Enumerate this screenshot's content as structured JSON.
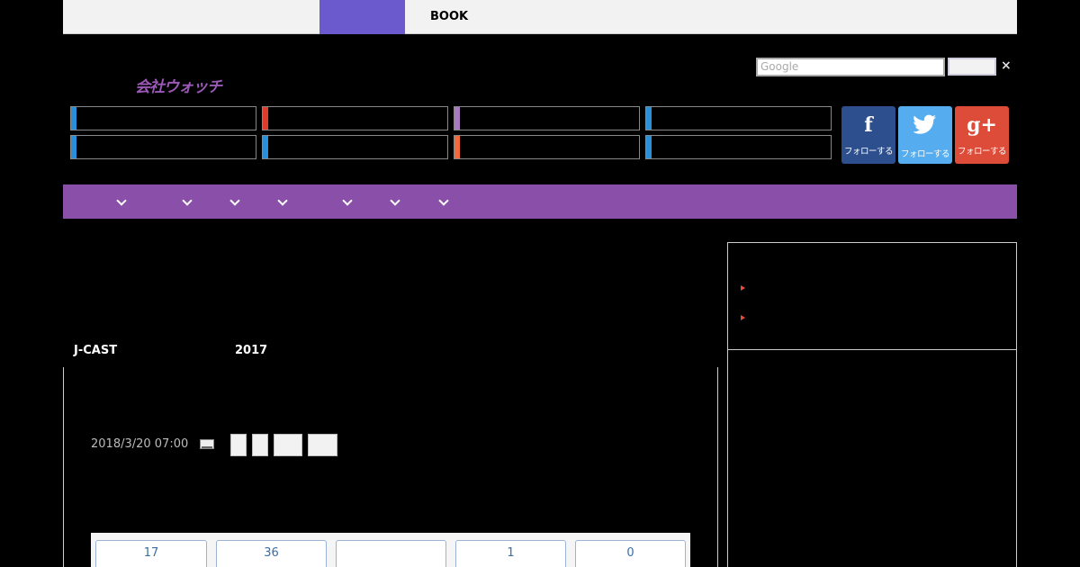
{
  "topnav": {
    "book_label": "BOOK"
  },
  "search": {
    "placeholder": "Google",
    "close": "×"
  },
  "logo": {
    "text": "会社ウォッチ"
  },
  "social": {
    "facebook": {
      "icon": "f",
      "label": "フォローする",
      "color": "#2d4f8e"
    },
    "twitter": {
      "icon": "t",
      "label": "フォローする",
      "color": "#55acee"
    },
    "google_plus": {
      "icon": "g+",
      "label": "フォローする",
      "color": "#dd4b39"
    }
  },
  "breadcrumb": {
    "source": "J-CAST",
    "year": "2017"
  },
  "article": {
    "date": "2018/3/20 07:00"
  },
  "counts": [
    "17",
    "36",
    "",
    "1",
    "0"
  ],
  "colors": {
    "accent": "#8a4fa8",
    "active_tab": "#6a5acd"
  }
}
